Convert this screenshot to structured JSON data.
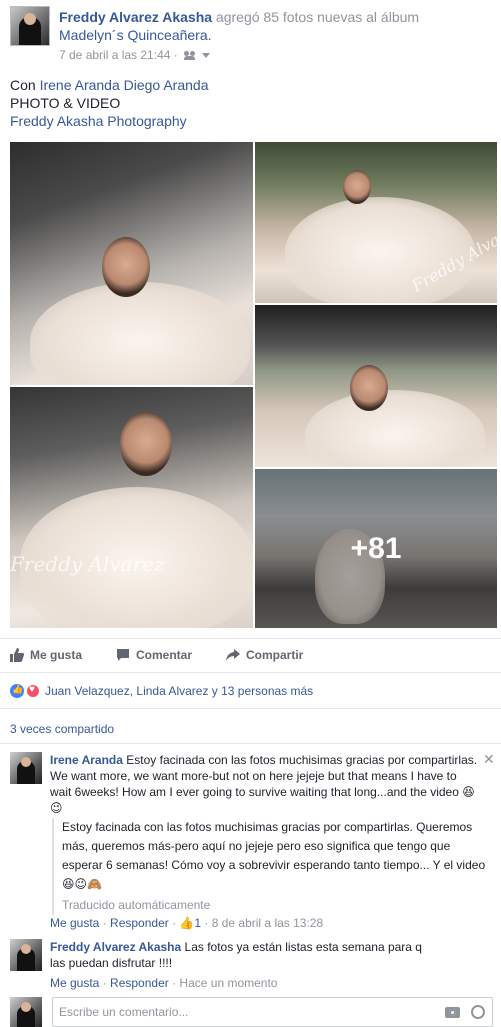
{
  "post": {
    "author": "Freddy Alvarez Akasha",
    "action_text": "agregó 85 fotos nuevas al álbum",
    "album": "Madelyn´s Quinceañera.",
    "timestamp": "7 de abril a las 21:44 ·",
    "with_prefix": "Con",
    "tagged": "Irene Aranda Diego Aranda",
    "line2": "PHOTO & VIDEO",
    "line3": "Freddy Akasha Photography",
    "more_photos": "+81"
  },
  "actions": {
    "like": "Me gusta",
    "comment": "Comentar",
    "share": "Compartir"
  },
  "reactions": {
    "text": "Juan Velazquez, Linda Alvarez y 13 personas más"
  },
  "shares": {
    "text": "3 veces compartido"
  },
  "comments": [
    {
      "author": "Irene Aranda",
      "text": "Estoy facinada con las fotos muchisimas gracias por compartirlas. We want more, we want more-but not on here jejeje but that means I have to wait 6weeks! How am I ever going to survive waiting that long...and the video",
      "emoji": "😆😉",
      "translation": "Estoy facinada con las fotos muchisimas gracias por compartirlas. Queremos más, queremos más-pero aquí no jejeje pero eso significa que tengo que esperar 6 semanas! Cómo voy a sobrevivir esperando tanto tiempo... Y el video",
      "translation_emoji": "😆😉🙈",
      "translated_label": "Traducido automáticamente",
      "like": "Me gusta",
      "reply": "Responder",
      "like_count": "1",
      "time": "8 de abril a las 13:28"
    },
    {
      "author": "Freddy Alvarez Akasha",
      "text": "Las fotos ya están listas esta semana para q las puedan disfrutar !!!!",
      "like": "Me gusta",
      "reply": "Responder",
      "time": "Hace un momento"
    }
  ],
  "composer": {
    "placeholder": "Escribe un comentario..."
  },
  "icons": [
    "people-icon",
    "chevron-down-icon",
    "like-icon",
    "comment-icon",
    "share-icon",
    "close-icon",
    "camera-icon",
    "smiley-icon"
  ],
  "colors": {
    "link": "#365899",
    "meta": "#90949c",
    "like": "#4080ff",
    "love": "#f25268"
  }
}
